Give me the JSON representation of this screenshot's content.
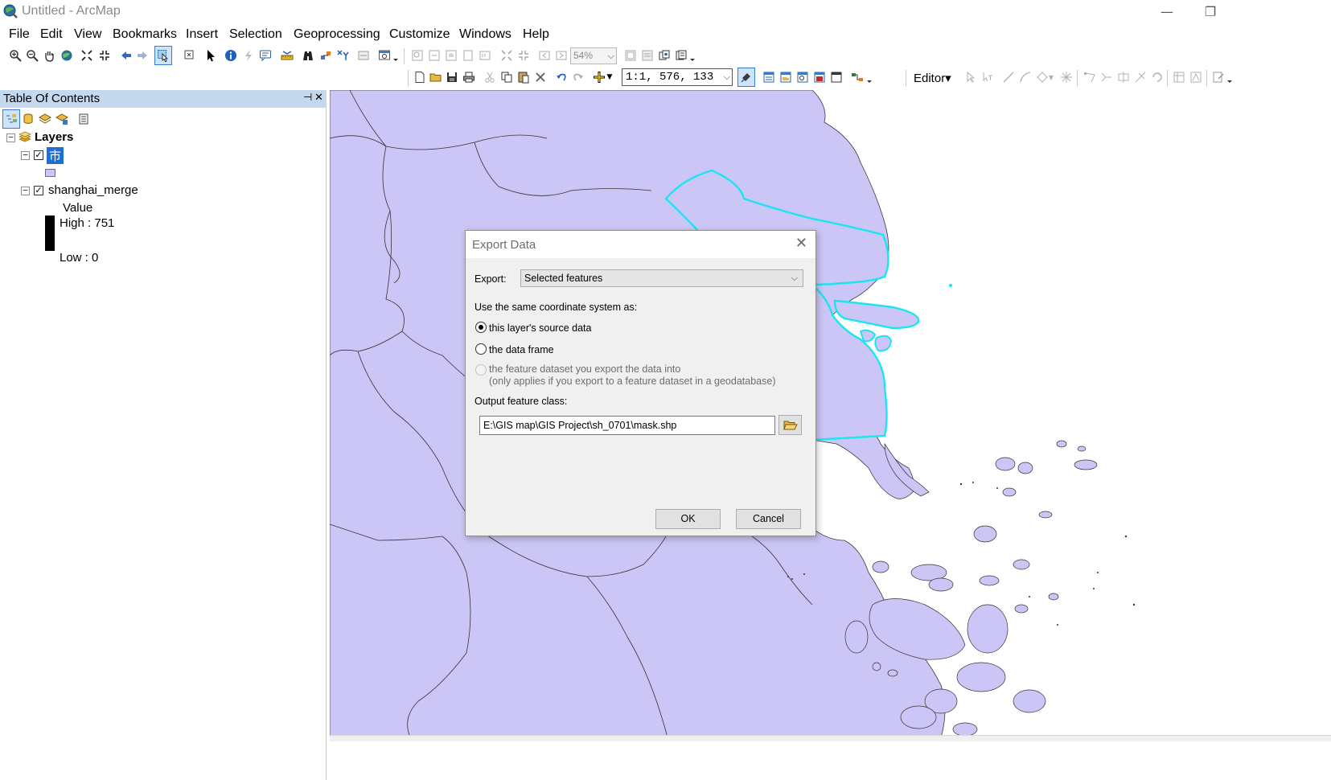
{
  "window": {
    "title": "Untitled - ArcMap",
    "minimize_glyph": "—",
    "restore_glyph": "❐"
  },
  "menubar": {
    "items": [
      "File",
      "Edit",
      "View",
      "Bookmarks",
      "Insert",
      "Selection",
      "Geoprocessing",
      "Customize",
      "Windows",
      "Help"
    ]
  },
  "toolbar": {
    "zoom_level": "54%",
    "scale": "1:1, 576, 133",
    "editor_label": "Editor▾"
  },
  "toc": {
    "title": "Table Of Contents",
    "pin_glyph": "⊣",
    "close_glyph": "✕",
    "layers_label": "Layers",
    "layer1": {
      "name": "市",
      "checked": true,
      "fill_color": "#cbc6f5"
    },
    "layer2": {
      "name": "shanghai_merge",
      "checked": true,
      "value_label": "Value",
      "high_label": "High : 751",
      "low_label": "Low : 0"
    }
  },
  "map": {
    "land_color": "#cbc6f5",
    "selection_color": "#00ffff"
  },
  "dialog": {
    "title": "Export Data",
    "close_glyph": "✕",
    "export_label": "Export:",
    "export_value": "Selected features",
    "coord_label": "Use the same coordinate system as:",
    "options": [
      {
        "label": "this layer's source data",
        "checked": true,
        "enabled": true
      },
      {
        "label": "the data frame",
        "checked": false,
        "enabled": true
      },
      {
        "label": "the feature dataset you export the data into",
        "checked": false,
        "enabled": false
      }
    ],
    "option3_note": "(only applies if you export to a feature dataset in a geodatabase)",
    "output_label": "Output feature class:",
    "output_value": "E:\\GIS map\\GIS Project\\sh_0701\\mask.shp",
    "ok_label": "OK",
    "cancel_label": "Cancel"
  }
}
